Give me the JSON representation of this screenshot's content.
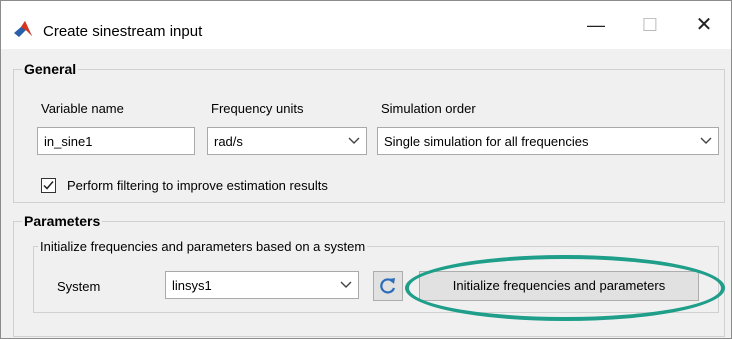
{
  "window": {
    "title": "Create sinestream input",
    "minimize_glyph": "—",
    "maximize_glyph": "☐",
    "close_glyph": "✕"
  },
  "general": {
    "legend": "General",
    "variable_name_label": "Variable name",
    "variable_name_value": "in_sine1",
    "frequency_units_label": "Frequency units",
    "frequency_units_value": "rad/s",
    "simulation_order_label": "Simulation order",
    "simulation_order_value": "Single simulation for all frequencies",
    "filter_checkbox_label": "Perform filtering to improve estimation results",
    "filter_checked": true
  },
  "parameters": {
    "legend": "Parameters",
    "init_legend": "Initialize frequencies and parameters based on a system",
    "system_label": "System",
    "system_value": "linsys1",
    "init_button_label": "Initialize frequencies and parameters"
  },
  "colors": {
    "highlight": "#1f9e8a",
    "app_icon_red": "#d9341c",
    "app_icon_blue": "#2a5ea8"
  },
  "icons": {
    "app": "matlab-logo-icon",
    "dropdown": "chevron-down-icon",
    "refresh": "refresh-icon",
    "check": "checkmark-icon"
  }
}
